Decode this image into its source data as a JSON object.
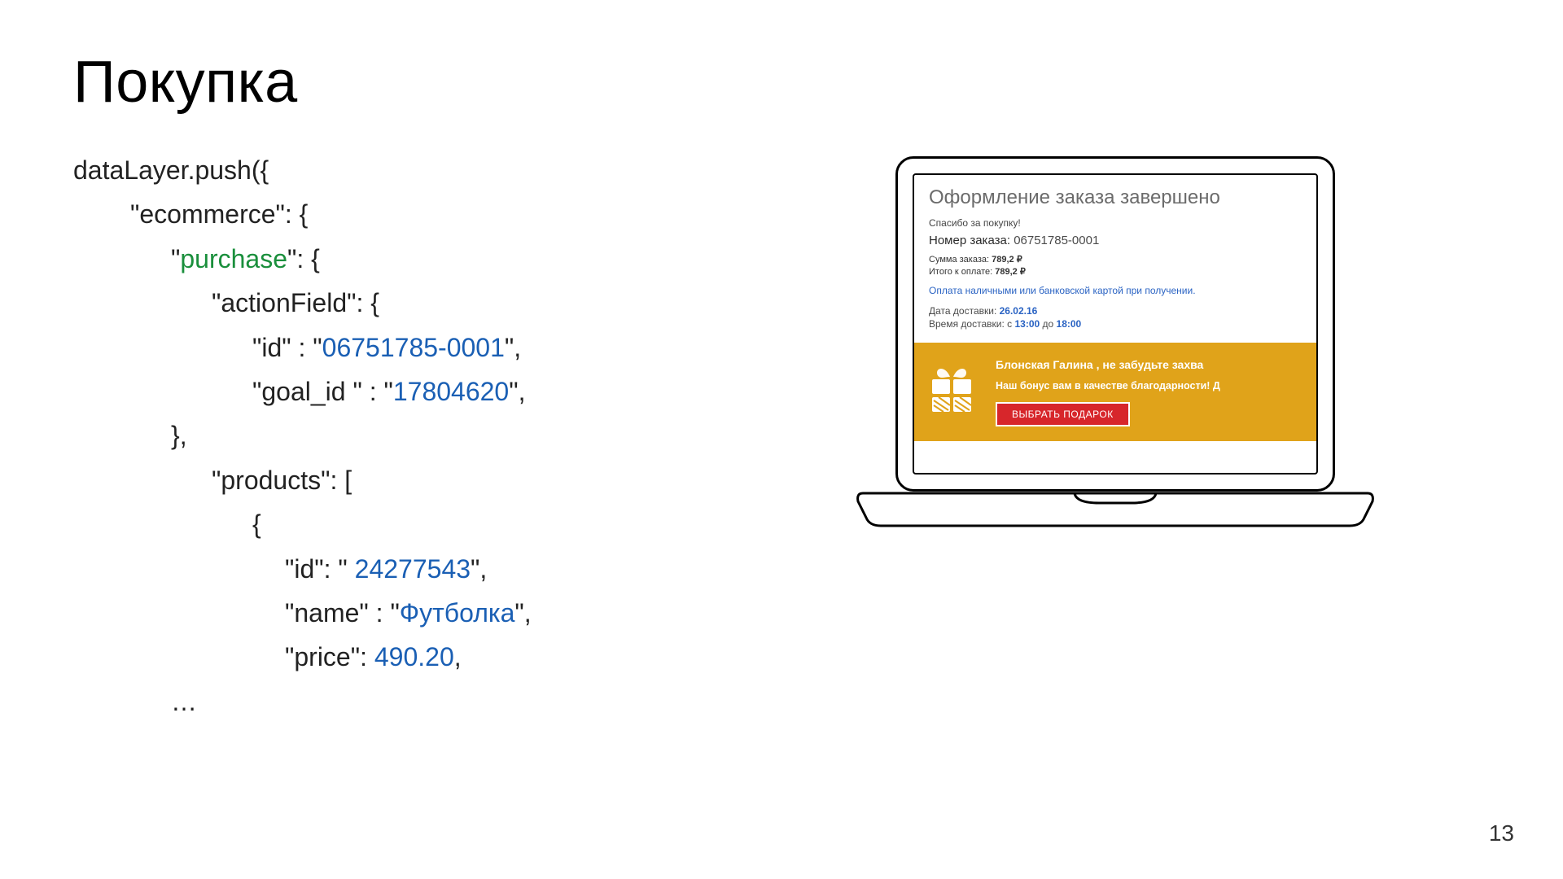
{
  "title": "Покупка",
  "code": {
    "l1": "dataLayer.push({",
    "l2a": "\"ecommerce\": {",
    "l3a": "\"",
    "l3b": "purchase",
    "l3c": "\": {",
    "l4a": "\"actionField\": {",
    "l5a": "\"id\" : \"",
    "l5b": "06751785-0001",
    "l5c": "\",",
    "l6a": "\"goal_id \" : \"",
    "l6b": "17804620",
    "l6c": "\",",
    "l7": "},",
    "l8": "\"products\": [",
    "l9": "{",
    "l10a": "\"id\": \" ",
    "l10b": "24277543",
    "l10c": "\",",
    "l11a": "\"name\" : \"",
    "l11b": "Футболка",
    "l11c": "\",",
    "l12a": "\"price\": ",
    "l12b": "490.20",
    "l12c": ",",
    "l13": "…"
  },
  "panel": {
    "title": "Оформление заказа завершено",
    "thanks": "Спасибо за покупку!",
    "order_label": "Номер заказа: ",
    "order_value": "06751785-0001",
    "sum1_label": "Сумма заказа: ",
    "sum1_value": "789,2 ₽",
    "sum2_label": "Итого к оплате: ",
    "sum2_value": "789,2 ₽",
    "payinfo": "Оплата наличными или банковской картой при получении.",
    "del_date_label": "Дата доставки: ",
    "del_date_value": "26.02.16",
    "del_time_label": "Время доставки: с ",
    "del_time_v1": "13:00",
    "del_time_mid": " до ",
    "del_time_v2": "18:00",
    "bonus_line1": "Блонская Галина , не забудьте захва",
    "bonus_line2": "Наш бонус вам в качестве благодарности! Д",
    "button": "ВЫБРАТЬ ПОДАРОК"
  },
  "page_number": "13"
}
